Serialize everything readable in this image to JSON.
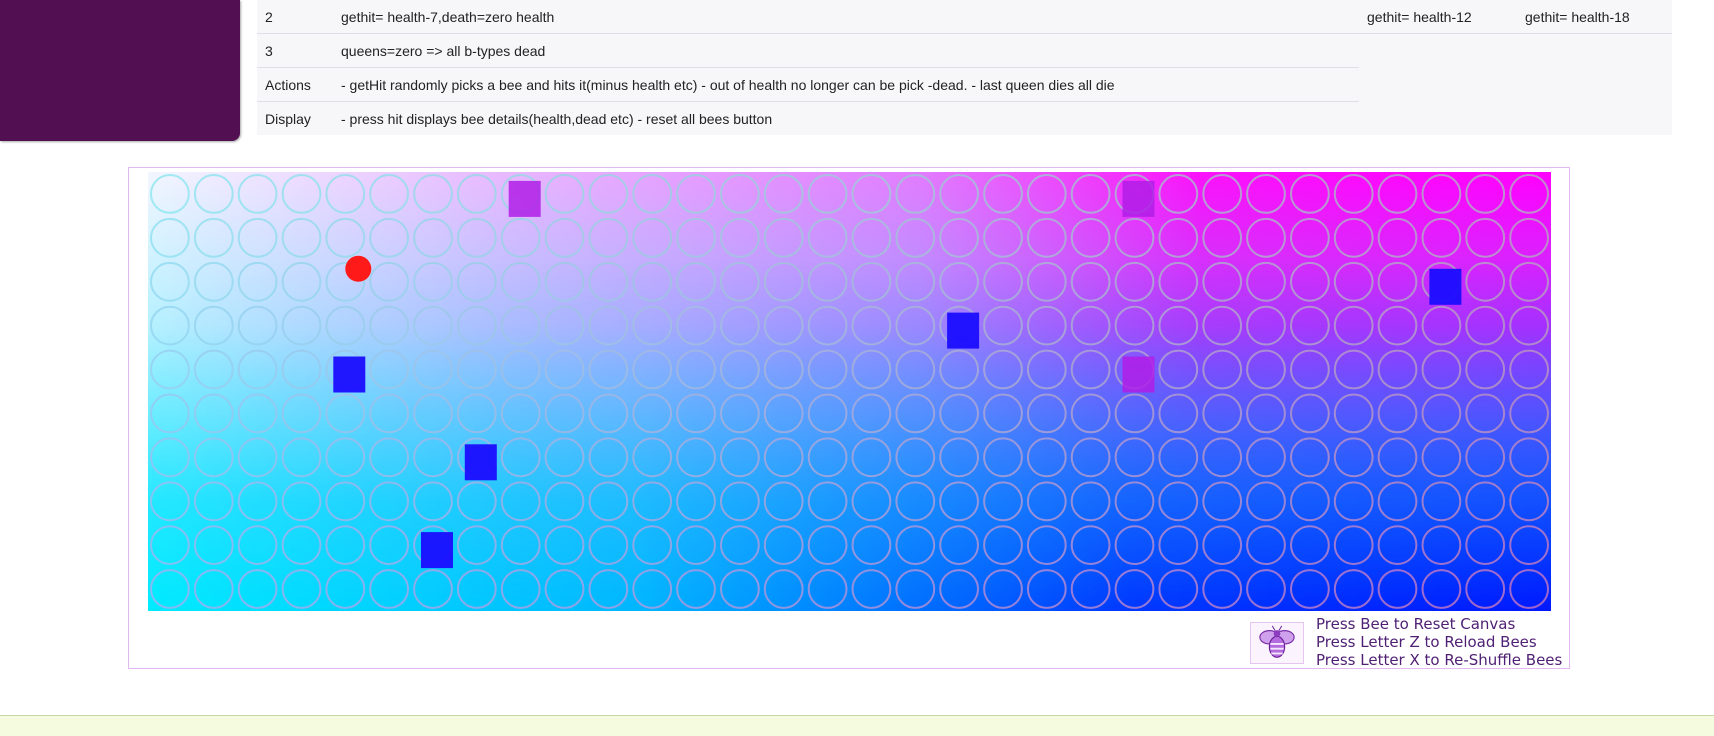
{
  "table": {
    "rows": [
      {
        "num": "2",
        "desc": "gethit= health-7,death=zero health",
        "col3": "gethit= health-12",
        "col4": "gethit= health-18"
      },
      {
        "num": "3",
        "desc": "queens=zero => all b-types dead"
      },
      {
        "num": "Actions",
        "desc": "- getHit randomly picks a bee and hits it(minus health etc) - out of health no longer can be pick -dead. - last queen dies all die"
      },
      {
        "num": "Display",
        "desc": "- press hit displays bee details(health,dead etc) - reset all bees button"
      }
    ]
  },
  "canvas": {
    "grid": {
      "cols": 32,
      "rows": 10
    },
    "colors": {
      "drone_square": "#1a0dff",
      "queen_square": "#b01de6",
      "hit_marker": "#ff1a1a"
    },
    "markers": [
      {
        "kind": "queen-square",
        "col": 8,
        "row": 0
      },
      {
        "kind": "queen-square",
        "col": 22,
        "row": 0
      },
      {
        "kind": "hit-dot",
        "col": 4,
        "row": 2
      },
      {
        "kind": "drone-square",
        "col": 29,
        "row": 2
      },
      {
        "kind": "drone-square",
        "col": 18,
        "row": 3
      },
      {
        "kind": "drone-square",
        "col": 4,
        "row": 4
      },
      {
        "kind": "queen-square",
        "col": 22,
        "row": 4
      },
      {
        "kind": "drone-square",
        "col": 7,
        "row": 6
      },
      {
        "kind": "drone-square",
        "col": 6,
        "row": 8
      }
    ]
  },
  "instructions": {
    "logo_icon": "bee-icon",
    "lines": [
      "Press Bee to Reset Canvas",
      "Press Letter Z to Reload Bees",
      "Press Letter X to Re-Shuffle Bees"
    ]
  }
}
